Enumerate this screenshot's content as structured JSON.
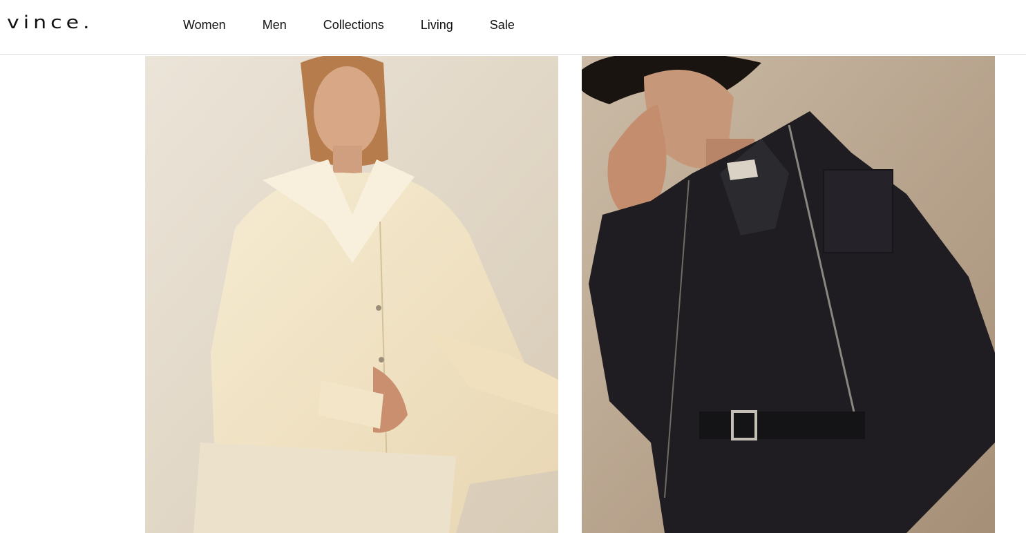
{
  "header": {
    "logo": "VINCE.",
    "nav": [
      {
        "label": "Women"
      },
      {
        "label": "Men"
      },
      {
        "label": "Collections"
      },
      {
        "label": "Living"
      },
      {
        "label": "Sale"
      }
    ]
  },
  "hero": {
    "left_image": {
      "icon": "women-editorial-photo"
    },
    "right_image": {
      "icon": "men-editorial-photo"
    }
  },
  "colors": {
    "left_bg": "#e6ddd0",
    "cream_shirt": "#f1e4c6",
    "right_bg": "#b9a893",
    "dark_jacket": "#1d1c1f"
  }
}
